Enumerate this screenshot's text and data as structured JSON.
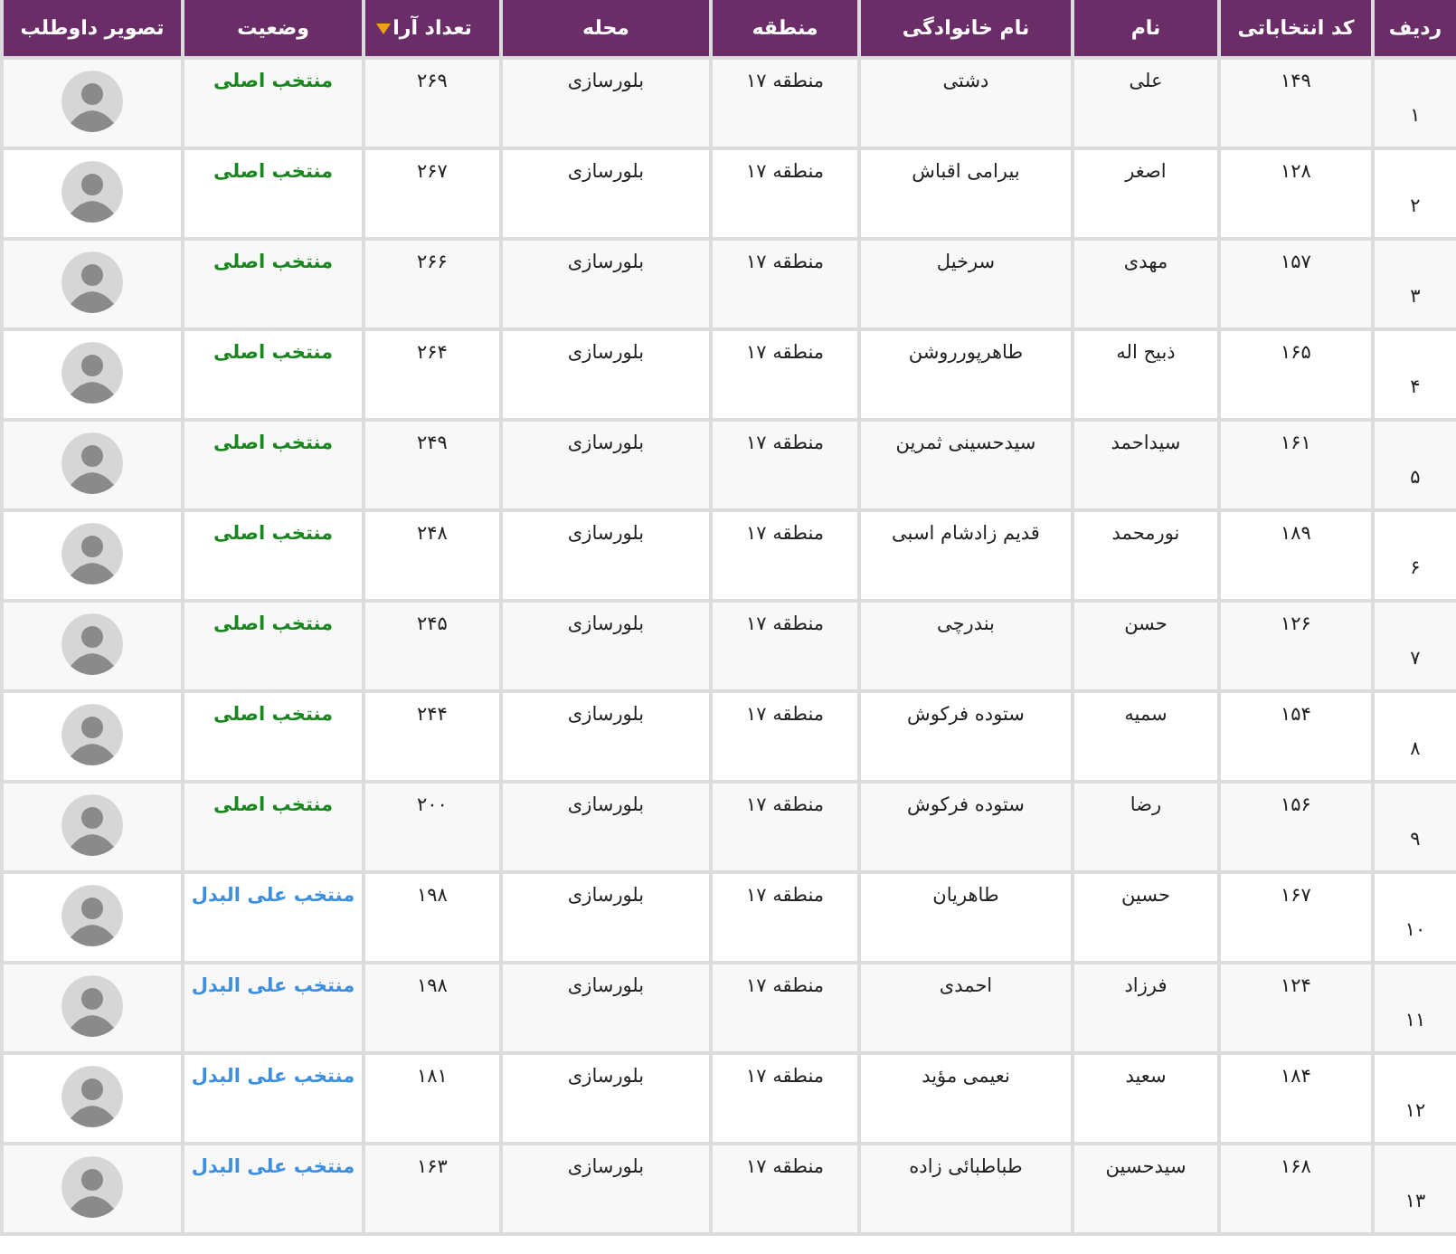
{
  "table": {
    "columns": [
      {
        "label": "ردیف",
        "sorted": false
      },
      {
        "label": "کد انتخاباتی",
        "sorted": false
      },
      {
        "label": "نام",
        "sorted": false
      },
      {
        "label": "نام خانوادگی",
        "sorted": false
      },
      {
        "label": "منطقه",
        "sorted": false
      },
      {
        "label": "محله",
        "sorted": false
      },
      {
        "label": "تعداد آرا",
        "sorted": true
      },
      {
        "label": "وضعیت",
        "sorted": false
      },
      {
        "label": "تصویر داوطلب",
        "sorted": false
      }
    ],
    "rows": [
      {
        "row": "۱",
        "code": "۱۴۹",
        "first_name": "علی",
        "last_name": "دشتی",
        "region": "منطقه ۱۷",
        "neighborhood": "بلورسازی",
        "votes": "۲۶۹",
        "status": "منتخب اصلی",
        "kind": "main"
      },
      {
        "row": "۲",
        "code": "۱۲۸",
        "first_name": "اصغر",
        "last_name": "بیرامی اقباش",
        "region": "منطقه ۱۷",
        "neighborhood": "بلورسازی",
        "votes": "۲۶۷",
        "status": "منتخب اصلی",
        "kind": "main"
      },
      {
        "row": "۳",
        "code": "۱۵۷",
        "first_name": "مهدی",
        "last_name": "سرخیل",
        "region": "منطقه ۱۷",
        "neighborhood": "بلورسازی",
        "votes": "۲۶۶",
        "status": "منتخب اصلی",
        "kind": "main"
      },
      {
        "row": "۴",
        "code": "۱۶۵",
        "first_name": "ذبیح اله",
        "last_name": "طاهرپورروشن",
        "region": "منطقه ۱۷",
        "neighborhood": "بلورسازی",
        "votes": "۲۶۴",
        "status": "منتخب اصلی",
        "kind": "main"
      },
      {
        "row": "۵",
        "code": "۱۶۱",
        "first_name": "سیداحمد",
        "last_name": "سیدحسینی ثمرین",
        "region": "منطقه ۱۷",
        "neighborhood": "بلورسازی",
        "votes": "۲۴۹",
        "status": "منتخب اصلی",
        "kind": "main"
      },
      {
        "row": "۶",
        "code": "۱۸۹",
        "first_name": "نورمحمد",
        "last_name": "قدیم زادشام اسبی",
        "region": "منطقه ۱۷",
        "neighborhood": "بلورسازی",
        "votes": "۲۴۸",
        "status": "منتخب اصلی",
        "kind": "main"
      },
      {
        "row": "۷",
        "code": "۱۲۶",
        "first_name": "حسن",
        "last_name": "بندرچی",
        "region": "منطقه ۱۷",
        "neighborhood": "بلورسازی",
        "votes": "۲۴۵",
        "status": "منتخب اصلی",
        "kind": "main"
      },
      {
        "row": "۸",
        "code": "۱۵۴",
        "first_name": "سمیه",
        "last_name": "ستوده فرکوش",
        "region": "منطقه ۱۷",
        "neighborhood": "بلورسازی",
        "votes": "۲۴۴",
        "status": "منتخب اصلی",
        "kind": "main"
      },
      {
        "row": "۹",
        "code": "۱۵۶",
        "first_name": "رضا",
        "last_name": "ستوده فرکوش",
        "region": "منطقه ۱۷",
        "neighborhood": "بلورسازی",
        "votes": "۲۰۰",
        "status": "منتخب اصلی",
        "kind": "main"
      },
      {
        "row": "۱۰",
        "code": "۱۶۷",
        "first_name": "حسین",
        "last_name": "طاهریان",
        "region": "منطقه ۱۷",
        "neighborhood": "بلورسازی",
        "votes": "۱۹۸",
        "status": "منتخب علی البدل",
        "kind": "alternate"
      },
      {
        "row": "۱۱",
        "code": "۱۲۴",
        "first_name": "فرزاد",
        "last_name": "احمدی",
        "region": "منطقه ۱۷",
        "neighborhood": "بلورسازی",
        "votes": "۱۹۸",
        "status": "منتخب علی البدل",
        "kind": "alternate"
      },
      {
        "row": "۱۲",
        "code": "۱۸۴",
        "first_name": "سعید",
        "last_name": "نعیمی مؤید",
        "region": "منطقه ۱۷",
        "neighborhood": "بلورسازی",
        "votes": "۱۸۱",
        "status": "منتخب علی البدل",
        "kind": "alternate"
      },
      {
        "row": "۱۳",
        "code": "۱۶۸",
        "first_name": "سیدحسین",
        "last_name": "طباطبائی زاده",
        "region": "منطقه ۱۷",
        "neighborhood": "بلورسازی",
        "votes": "۱۶۳",
        "status": "منتخب علی البدل",
        "kind": "alternate"
      }
    ]
  }
}
